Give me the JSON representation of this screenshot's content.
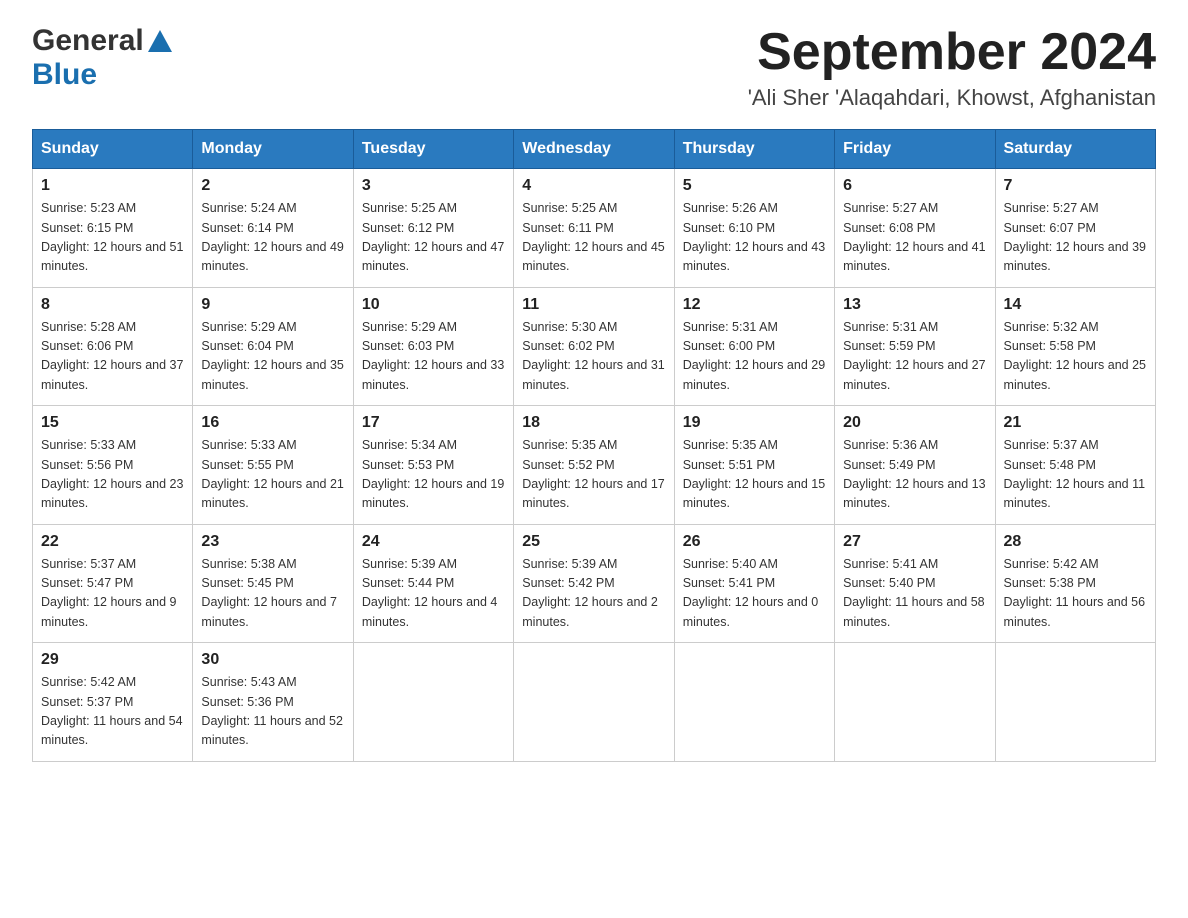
{
  "header": {
    "logo_general": "General",
    "logo_blue": "Blue",
    "month_title": "September 2024",
    "location": "'Ali Sher 'Alaqahdari, Khowst, Afghanistan"
  },
  "weekdays": [
    "Sunday",
    "Monday",
    "Tuesday",
    "Wednesday",
    "Thursday",
    "Friday",
    "Saturday"
  ],
  "weeks": [
    [
      {
        "day": "1",
        "sunrise": "5:23 AM",
        "sunset": "6:15 PM",
        "daylight": "12 hours and 51 minutes."
      },
      {
        "day": "2",
        "sunrise": "5:24 AM",
        "sunset": "6:14 PM",
        "daylight": "12 hours and 49 minutes."
      },
      {
        "day": "3",
        "sunrise": "5:25 AM",
        "sunset": "6:12 PM",
        "daylight": "12 hours and 47 minutes."
      },
      {
        "day": "4",
        "sunrise": "5:25 AM",
        "sunset": "6:11 PM",
        "daylight": "12 hours and 45 minutes."
      },
      {
        "day": "5",
        "sunrise": "5:26 AM",
        "sunset": "6:10 PM",
        "daylight": "12 hours and 43 minutes."
      },
      {
        "day": "6",
        "sunrise": "5:27 AM",
        "sunset": "6:08 PM",
        "daylight": "12 hours and 41 minutes."
      },
      {
        "day": "7",
        "sunrise": "5:27 AM",
        "sunset": "6:07 PM",
        "daylight": "12 hours and 39 minutes."
      }
    ],
    [
      {
        "day": "8",
        "sunrise": "5:28 AM",
        "sunset": "6:06 PM",
        "daylight": "12 hours and 37 minutes."
      },
      {
        "day": "9",
        "sunrise": "5:29 AM",
        "sunset": "6:04 PM",
        "daylight": "12 hours and 35 minutes."
      },
      {
        "day": "10",
        "sunrise": "5:29 AM",
        "sunset": "6:03 PM",
        "daylight": "12 hours and 33 minutes."
      },
      {
        "day": "11",
        "sunrise": "5:30 AM",
        "sunset": "6:02 PM",
        "daylight": "12 hours and 31 minutes."
      },
      {
        "day": "12",
        "sunrise": "5:31 AM",
        "sunset": "6:00 PM",
        "daylight": "12 hours and 29 minutes."
      },
      {
        "day": "13",
        "sunrise": "5:31 AM",
        "sunset": "5:59 PM",
        "daylight": "12 hours and 27 minutes."
      },
      {
        "day": "14",
        "sunrise": "5:32 AM",
        "sunset": "5:58 PM",
        "daylight": "12 hours and 25 minutes."
      }
    ],
    [
      {
        "day": "15",
        "sunrise": "5:33 AM",
        "sunset": "5:56 PM",
        "daylight": "12 hours and 23 minutes."
      },
      {
        "day": "16",
        "sunrise": "5:33 AM",
        "sunset": "5:55 PM",
        "daylight": "12 hours and 21 minutes."
      },
      {
        "day": "17",
        "sunrise": "5:34 AM",
        "sunset": "5:53 PM",
        "daylight": "12 hours and 19 minutes."
      },
      {
        "day": "18",
        "sunrise": "5:35 AM",
        "sunset": "5:52 PM",
        "daylight": "12 hours and 17 minutes."
      },
      {
        "day": "19",
        "sunrise": "5:35 AM",
        "sunset": "5:51 PM",
        "daylight": "12 hours and 15 minutes."
      },
      {
        "day": "20",
        "sunrise": "5:36 AM",
        "sunset": "5:49 PM",
        "daylight": "12 hours and 13 minutes."
      },
      {
        "day": "21",
        "sunrise": "5:37 AM",
        "sunset": "5:48 PM",
        "daylight": "12 hours and 11 minutes."
      }
    ],
    [
      {
        "day": "22",
        "sunrise": "5:37 AM",
        "sunset": "5:47 PM",
        "daylight": "12 hours and 9 minutes."
      },
      {
        "day": "23",
        "sunrise": "5:38 AM",
        "sunset": "5:45 PM",
        "daylight": "12 hours and 7 minutes."
      },
      {
        "day": "24",
        "sunrise": "5:39 AM",
        "sunset": "5:44 PM",
        "daylight": "12 hours and 4 minutes."
      },
      {
        "day": "25",
        "sunrise": "5:39 AM",
        "sunset": "5:42 PM",
        "daylight": "12 hours and 2 minutes."
      },
      {
        "day": "26",
        "sunrise": "5:40 AM",
        "sunset": "5:41 PM",
        "daylight": "12 hours and 0 minutes."
      },
      {
        "day": "27",
        "sunrise": "5:41 AM",
        "sunset": "5:40 PM",
        "daylight": "11 hours and 58 minutes."
      },
      {
        "day": "28",
        "sunrise": "5:42 AM",
        "sunset": "5:38 PM",
        "daylight": "11 hours and 56 minutes."
      }
    ],
    [
      {
        "day": "29",
        "sunrise": "5:42 AM",
        "sunset": "5:37 PM",
        "daylight": "11 hours and 54 minutes."
      },
      {
        "day": "30",
        "sunrise": "5:43 AM",
        "sunset": "5:36 PM",
        "daylight": "11 hours and 52 minutes."
      },
      null,
      null,
      null,
      null,
      null
    ]
  ],
  "labels": {
    "sunrise_prefix": "Sunrise: ",
    "sunset_prefix": "Sunset: ",
    "daylight_prefix": "Daylight: "
  }
}
